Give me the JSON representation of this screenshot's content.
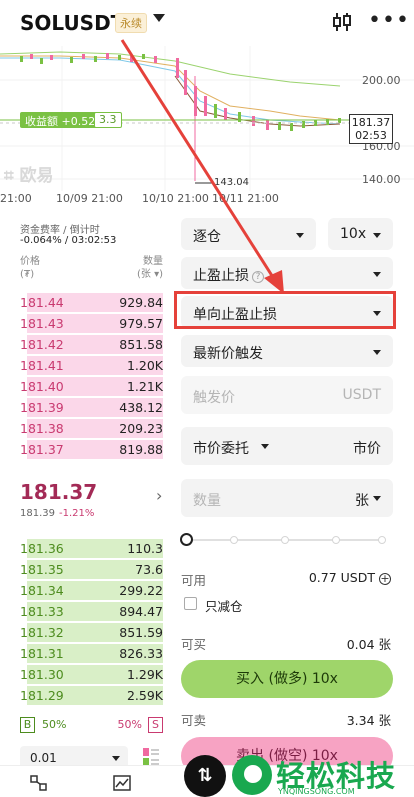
{
  "header": {
    "symbol": "SOLUSDT",
    "perp_badge": "永续",
    "icons": [
      "chevron-down-icon",
      "kline-chart-icon",
      "more-icon"
    ]
  },
  "chart": {
    "profit_label": "收益额 +0.52",
    "profit_qty": "3.3",
    "price_axis": [
      "200.00",
      "160.00",
      "140.00"
    ],
    "current_price": "181.37",
    "countdown": "02:53",
    "low_marker": "143.04",
    "watermark": "欧易",
    "dates": [
      "21:00",
      "10/09 21:00",
      "10/10 21:00",
      "10/11 21:00"
    ],
    "colors": {
      "candle_up": "#7ac143",
      "candle_down": "#f06aa0",
      "ma1": "#9bd36e",
      "ma2": "#e0b060",
      "ma3": "#7fc8e8"
    }
  },
  "orderbook": {
    "funding_title": "资金费率 / 倒计时",
    "funding_value": "-0.064% / 03:02:53",
    "price_header": "价格",
    "price_unit": "(₮)",
    "qty_header": "数量",
    "qty_unit": "(张 ▾)",
    "asks": [
      {
        "price": "181.44",
        "qty": "929.84",
        "depth": 0.78
      },
      {
        "price": "181.43",
        "qty": "979.57",
        "depth": 0.78
      },
      {
        "price": "181.42",
        "qty": "851.58",
        "depth": 0.78
      },
      {
        "price": "181.41",
        "qty": "1.20K",
        "depth": 0.78
      },
      {
        "price": "181.40",
        "qty": "1.21K",
        "depth": 0.78
      },
      {
        "price": "181.39",
        "qty": "438.12",
        "depth": 0.78
      },
      {
        "price": "181.38",
        "qty": "209.23",
        "depth": 0.78
      },
      {
        "price": "181.37",
        "qty": "819.88",
        "depth": 0.78
      }
    ],
    "last_price": "181.37",
    "mark_price": "181.39",
    "change": "-1.21%",
    "bids": [
      {
        "price": "181.36",
        "qty": "110.3",
        "depth": 0.78
      },
      {
        "price": "181.35",
        "qty": "73.6",
        "depth": 0.78
      },
      {
        "price": "181.34",
        "qty": "299.22",
        "depth": 0.78
      },
      {
        "price": "181.33",
        "qty": "894.47",
        "depth": 0.78
      },
      {
        "price": "181.32",
        "qty": "851.59",
        "depth": 0.78
      },
      {
        "price": "181.31",
        "qty": "826.33",
        "depth": 0.78
      },
      {
        "price": "181.30",
        "qty": "1.29K",
        "depth": 0.78
      },
      {
        "price": "181.29",
        "qty": "2.59K",
        "depth": 0.78
      }
    ],
    "buy_tag": "B",
    "buy_ratio": "50%",
    "sell_ratio": "50%",
    "sell_tag": "S",
    "depth_value": "0.01"
  },
  "form": {
    "margin_mode": "逐仓",
    "leverage": "10x",
    "order_type": "止盈止损",
    "tpsl_mode": "单向止盈止损",
    "trigger_type": "最新价触发",
    "trigger_placeholder": "触发价",
    "trigger_unit": "USDT",
    "exec_type": "市价委托",
    "exec_value": "市价",
    "qty_placeholder": "数量",
    "qty_unit": "张",
    "available_label": "可用",
    "available_value": "0.77 USDT",
    "reduce_only": "只减仓",
    "can_buy_label": "可买",
    "can_buy_value": "0.04 张",
    "buy_button": "买入 (做多) 10x",
    "can_sell_label": "可卖",
    "can_sell_value": "3.34 张",
    "sell_button": "卖出 (做空) 10x"
  },
  "bottom": {
    "brand_name": "轻松科技",
    "brand_url": "YNQINGSONG.COM"
  }
}
